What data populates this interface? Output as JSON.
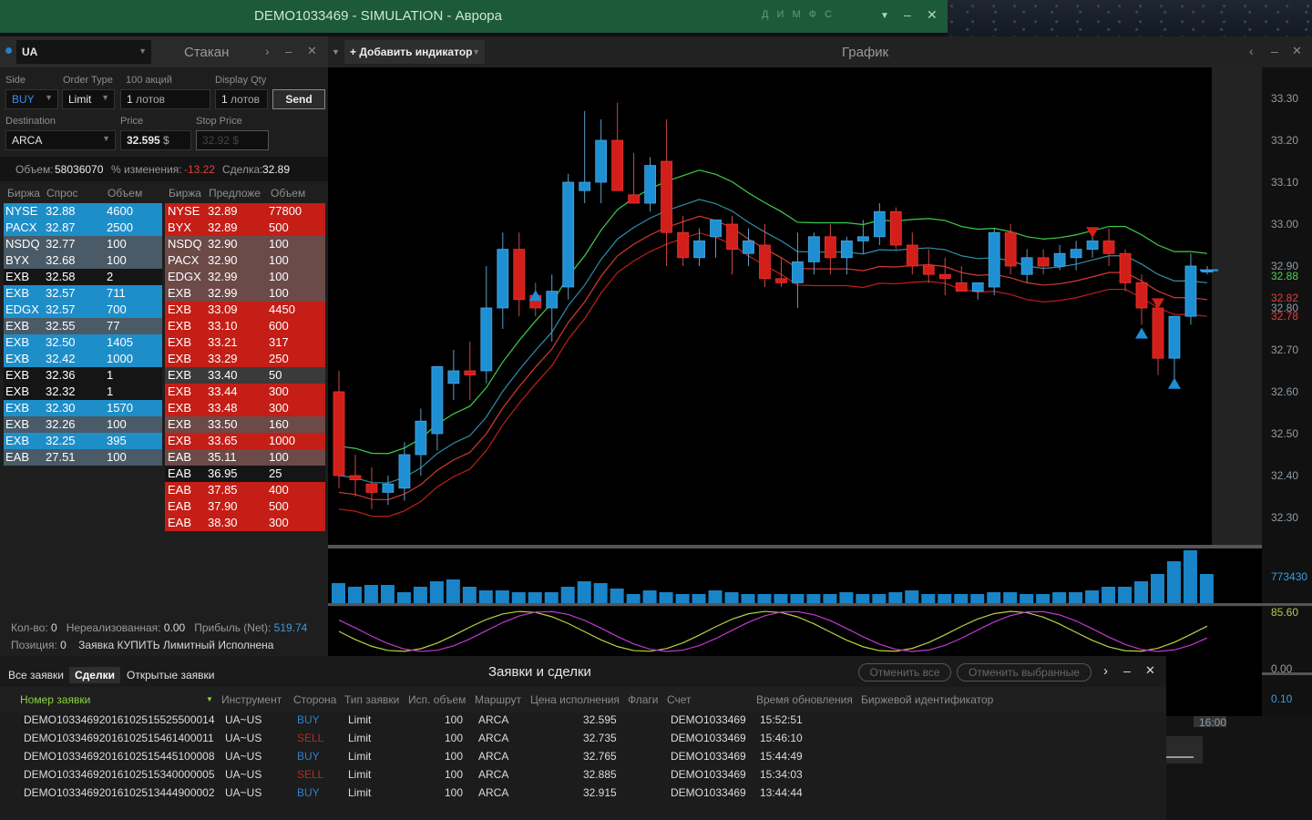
{
  "window": {
    "title": "DEMO1033469 - SIMULATION - Аврора",
    "tray_icons": "Д И М Ф С"
  },
  "order_panel": {
    "symbol": "UA",
    "panel_title": "Стакан",
    "side_label": "Side",
    "side_value": "BUY",
    "order_type_label": "Order Type",
    "order_type_value": "Limit",
    "shares_label": "100 акций",
    "qty_value": "1",
    "qty_unit": "лотов",
    "display_qty_label": "Display Qty",
    "display_qty_value": "1",
    "send_label": "Send",
    "destination_label": "Destination",
    "destination_value": "ARCA",
    "price_label": "Price",
    "price_value": "32.595",
    "stop_price_label": "Stop Price",
    "stop_price_placeholder": "32.92 $",
    "currency": "$",
    "volume_label": "Объем:",
    "volume_value": "58036070",
    "change_label": "% изменения:",
    "change_value": "-13.22",
    "trade_label": "Сделка:",
    "trade_value": "32.89"
  },
  "book": {
    "bid_headers": [
      "Биржа",
      "Спрос",
      "Объем"
    ],
    "ask_headers": [
      "Биржа",
      "Предложе",
      "Объем"
    ],
    "bids": [
      {
        "ex": "NYSE",
        "price": "32.88",
        "vol": "4600",
        "color": "#1e8ec9"
      },
      {
        "ex": "PACX",
        "price": "32.87",
        "vol": "2500",
        "color": "#1e8ec9"
      },
      {
        "ex": "NSDQ",
        "price": "32.77",
        "vol": "100",
        "color": "#4a5a66"
      },
      {
        "ex": "BYX",
        "price": "32.68",
        "vol": "100",
        "color": "#4a5a66"
      },
      {
        "ex": "EXB",
        "price": "32.58",
        "vol": "2",
        "color": "#151515"
      },
      {
        "ex": "EXB",
        "price": "32.57",
        "vol": "711",
        "color": "#1e8ec9"
      },
      {
        "ex": "EDGX",
        "price": "32.57",
        "vol": "700",
        "color": "#1e8ec9"
      },
      {
        "ex": "EXB",
        "price": "32.55",
        "vol": "77",
        "color": "#4a5a66"
      },
      {
        "ex": "EXB",
        "price": "32.50",
        "vol": "1405",
        "color": "#1e8ec9"
      },
      {
        "ex": "EXB",
        "price": "32.42",
        "vol": "1000",
        "color": "#1e8ec9"
      },
      {
        "ex": "EXB",
        "price": "32.36",
        "vol": "1",
        "color": "#151515"
      },
      {
        "ex": "EXB",
        "price": "32.32",
        "vol": "1",
        "color": "#151515"
      },
      {
        "ex": "EXB",
        "price": "32.30",
        "vol": "1570",
        "color": "#1e8ec9"
      },
      {
        "ex": "EXB",
        "price": "32.26",
        "vol": "100",
        "color": "#4a5a66"
      },
      {
        "ex": "EXB",
        "price": "32.25",
        "vol": "395",
        "color": "#1e8ec9"
      },
      {
        "ex": "EAB",
        "price": "27.51",
        "vol": "100",
        "color": "#4a5a66"
      }
    ],
    "asks": [
      {
        "ex": "NYSE",
        "price": "32.89",
        "vol": "77800",
        "color": "#c41e16"
      },
      {
        "ex": "BYX",
        "price": "32.89",
        "vol": "500",
        "color": "#c41e16"
      },
      {
        "ex": "NSDQ",
        "price": "32.90",
        "vol": "100",
        "color": "#6b4a48"
      },
      {
        "ex": "PACX",
        "price": "32.90",
        "vol": "100",
        "color": "#6b4a48"
      },
      {
        "ex": "EDGX",
        "price": "32.99",
        "vol": "100",
        "color": "#6b4a48"
      },
      {
        "ex": "EXB",
        "price": "32.99",
        "vol": "100",
        "color": "#6b4a48"
      },
      {
        "ex": "EXB",
        "price": "33.09",
        "vol": "4450",
        "color": "#c41e16"
      },
      {
        "ex": "EXB",
        "price": "33.10",
        "vol": "600",
        "color": "#c41e16"
      },
      {
        "ex": "EXB",
        "price": "33.21",
        "vol": "317",
        "color": "#c41e16"
      },
      {
        "ex": "EXB",
        "price": "33.29",
        "vol": "250",
        "color": "#c41e16"
      },
      {
        "ex": "EXB",
        "price": "33.40",
        "vol": "50",
        "color": "#3a3a3a"
      },
      {
        "ex": "EXB",
        "price": "33.44",
        "vol": "300",
        "color": "#c41e16"
      },
      {
        "ex": "EXB",
        "price": "33.48",
        "vol": "300",
        "color": "#c41e16"
      },
      {
        "ex": "EXB",
        "price": "33.50",
        "vol": "160",
        "color": "#6b4a48"
      },
      {
        "ex": "EXB",
        "price": "33.65",
        "vol": "1000",
        "color": "#c41e16"
      },
      {
        "ex": "EAB",
        "price": "35.11",
        "vol": "100",
        "color": "#6b4a48"
      },
      {
        "ex": "EAB",
        "price": "36.95",
        "vol": "25",
        "color": "#151515"
      },
      {
        "ex": "EAB",
        "price": "37.85",
        "vol": "400",
        "color": "#c41e16"
      },
      {
        "ex": "EAB",
        "price": "37.90",
        "vol": "500",
        "color": "#c41e16"
      },
      {
        "ex": "EAB",
        "price": "38.30",
        "vol": "300",
        "color": "#c41e16"
      }
    ]
  },
  "position": {
    "qty_label": "Кол-во:",
    "qty_value": "0",
    "unrealized_label": "Нереализованная:",
    "unrealized_value": "0.00",
    "profit_label": "Прибыль (Net):",
    "profit_value": "519.74",
    "pos_label": "Позиция:",
    "pos_value": "0",
    "status_text": "Заявка КУПИТЬ Лимитный Исполнена"
  },
  "chart_header": {
    "add_indicator": "+ Добавить индикатор",
    "title": "График"
  },
  "chart_axis": {
    "ticks": [
      "33.30",
      "33.20",
      "33.10",
      "33.00",
      "32.90",
      "32.80",
      "32.70",
      "32.60",
      "32.50",
      "32.40",
      "32.30"
    ],
    "tag_green": "32.88",
    "tag_red1": "32.82",
    "tag_red2": "32.78",
    "volume_tag": "773430",
    "osc_tag_top": "85.60",
    "osc_tag_zero": "0.00",
    "osc_tag_bottom": "0.10",
    "time_label": "16:00"
  },
  "chart_data": {
    "type": "candlestick",
    "candles": [
      [
        32.6,
        32.65,
        32.37,
        32.4
      ],
      [
        32.4,
        32.45,
        32.35,
        32.39
      ],
      [
        32.38,
        32.42,
        32.32,
        32.36
      ],
      [
        32.36,
        32.4,
        32.33,
        32.38
      ],
      [
        32.37,
        32.48,
        32.34,
        32.45
      ],
      [
        32.45,
        32.56,
        32.4,
        32.53
      ],
      [
        32.5,
        32.62,
        32.46,
        32.66
      ],
      [
        32.62,
        32.7,
        32.58,
        32.65
      ],
      [
        32.65,
        32.72,
        32.58,
        32.64
      ],
      [
        32.65,
        32.9,
        32.62,
        32.8
      ],
      [
        32.8,
        32.98,
        32.75,
        32.94
      ],
      [
        32.94,
        32.98,
        32.78,
        32.82
      ],
      [
        32.83,
        32.86,
        32.78,
        32.8
      ],
      [
        32.8,
        32.88,
        32.72,
        32.84
      ],
      [
        32.85,
        33.12,
        32.82,
        33.1
      ],
      [
        33.08,
        33.27,
        33.05,
        33.1
      ],
      [
        33.1,
        33.25,
        33.05,
        33.2
      ],
      [
        33.2,
        33.29,
        33.08,
        33.08
      ],
      [
        33.07,
        33.17,
        33.05,
        33.05
      ],
      [
        33.05,
        33.16,
        33.03,
        33.14
      ],
      [
        33.15,
        33.25,
        32.9,
        32.98
      ],
      [
        32.98,
        33.02,
        32.9,
        32.92
      ],
      [
        32.92,
        32.99,
        32.9,
        32.96
      ],
      [
        32.97,
        33.0,
        32.92,
        33.01
      ],
      [
        33.0,
        33.02,
        32.88,
        32.94
      ],
      [
        32.93,
        32.99,
        32.9,
        32.96
      ],
      [
        32.95,
        33.0,
        32.85,
        32.87
      ],
      [
        32.87,
        32.92,
        32.85,
        32.86
      ],
      [
        32.86,
        32.98,
        32.8,
        32.91
      ],
      [
        32.91,
        32.98,
        32.88,
        32.97
      ],
      [
        32.97,
        33.0,
        32.88,
        32.92
      ],
      [
        32.92,
        32.97,
        32.88,
        32.96
      ],
      [
        32.96,
        33.01,
        32.93,
        32.97
      ],
      [
        32.97,
        33.05,
        32.95,
        33.03
      ],
      [
        33.03,
        33.04,
        32.94,
        32.95
      ],
      [
        32.95,
        32.98,
        32.88,
        32.9
      ],
      [
        32.9,
        32.94,
        32.86,
        32.88
      ],
      [
        32.88,
        32.92,
        32.83,
        32.87
      ],
      [
        32.86,
        32.9,
        32.84,
        32.84
      ],
      [
        32.84,
        32.86,
        32.82,
        32.86
      ],
      [
        32.85,
        32.99,
        32.83,
        32.98
      ],
      [
        32.98,
        33.0,
        32.88,
        32.9
      ],
      [
        32.88,
        32.94,
        32.86,
        32.92
      ],
      [
        32.92,
        32.94,
        32.88,
        32.9
      ],
      [
        32.9,
        32.95,
        32.89,
        32.93
      ],
      [
        32.92,
        32.96,
        32.89,
        32.94
      ],
      [
        32.94,
        32.98,
        32.92,
        32.96
      ],
      [
        32.96,
        32.99,
        32.9,
        32.93
      ],
      [
        32.93,
        32.94,
        32.84,
        32.86
      ],
      [
        32.86,
        32.88,
        32.76,
        32.8
      ],
      [
        32.8,
        32.82,
        32.64,
        32.68
      ],
      [
        32.68,
        32.78,
        32.62,
        32.78
      ],
      [
        32.78,
        32.93,
        32.76,
        32.9
      ],
      [
        32.89,
        32.9,
        32.88,
        32.89
      ]
    ],
    "markers_up": [
      [
        12,
        32.83
      ],
      [
        49,
        32.74
      ],
      [
        51,
        32.62
      ]
    ],
    "markers_down": [
      [
        46,
        32.98
      ],
      [
        50,
        32.81
      ]
    ]
  },
  "bottom": {
    "tabs": [
      "Все заявки",
      "Сделки",
      "Открытые заявки"
    ],
    "active_tab": 1,
    "title": "Заявки и сделки",
    "cancel_all": "Отменить все",
    "cancel_selected": "Отменить выбранные",
    "columns": [
      "Номер заявки",
      "Инструмент",
      "Сторона",
      "Тип заявки",
      "Исп. объем",
      "Маршрут",
      "Цена исполнения",
      "Флаги",
      "Счет",
      "Время обновления",
      "Биржевой идентификатор"
    ],
    "rows": [
      {
        "id": "DEMO10334692016102515525500014",
        "inst": "UA~US",
        "side": "BUY",
        "type": "Limit",
        "qty": "100",
        "route": "ARCA",
        "price": "32.595",
        "acct": "DEMO1033469",
        "time": "15:52:51"
      },
      {
        "id": "DEMO10334692016102515461400011",
        "inst": "UA~US",
        "side": "SELL",
        "type": "Limit",
        "qty": "100",
        "route": "ARCA",
        "price": "32.735",
        "acct": "DEMO1033469",
        "time": "15:46:10"
      },
      {
        "id": "DEMO10334692016102515445100008",
        "inst": "UA~US",
        "side": "BUY",
        "type": "Limit",
        "qty": "100",
        "route": "ARCA",
        "price": "32.765",
        "acct": "DEMO1033469",
        "time": "15:44:49"
      },
      {
        "id": "DEMO10334692016102515340000005",
        "inst": "UA~US",
        "side": "SELL",
        "type": "Limit",
        "qty": "100",
        "route": "ARCA",
        "price": "32.885",
        "acct": "DEMO1033469",
        "time": "15:34:03"
      },
      {
        "id": "DEMO10334692016102513444900002",
        "inst": "UA~US",
        "side": "BUY",
        "type": "Limit",
        "qty": "100",
        "route": "ARCA",
        "price": "32.915",
        "acct": "DEMO1033469",
        "time": "13:44:44"
      }
    ]
  }
}
